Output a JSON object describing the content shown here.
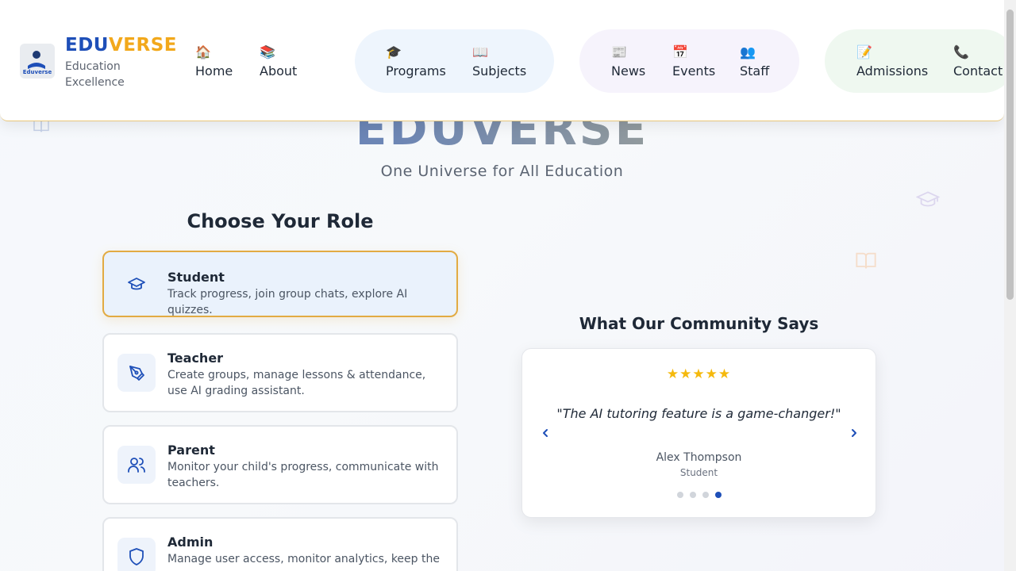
{
  "brand": {
    "name_part1": "EDU",
    "name_part2": "VERSE",
    "tagline": "Education Excellence",
    "logo_text": "Eduverse"
  },
  "nav": [
    {
      "icon": "🏠",
      "label": "Home"
    },
    {
      "icon": "📚",
      "label": "About"
    },
    {
      "icon": "🎓",
      "label": "Programs"
    },
    {
      "icon": "📖",
      "label": "Subjects"
    },
    {
      "icon": "📰",
      "label": "News"
    },
    {
      "icon": "📅",
      "label": "Events"
    },
    {
      "icon": "👥",
      "label": "Staff"
    },
    {
      "icon": "📝",
      "label": "Admissions"
    },
    {
      "icon": "📞",
      "label": "Contact"
    }
  ],
  "hero": {
    "title": "EDUVERSE",
    "subtitle": "One Universe for All Education"
  },
  "roles": {
    "title": "Choose Your Role",
    "items": [
      {
        "name": "Student",
        "desc": "Track progress, join group chats, explore AI quizzes.",
        "icon": "graduation-cap-icon",
        "active": true
      },
      {
        "name": "Teacher",
        "desc": "Create groups, manage lessons & attendance, use AI grading assistant.",
        "icon": "pen-tool-icon",
        "active": false
      },
      {
        "name": "Parent",
        "desc": "Monitor your child's progress, communicate with teachers.",
        "icon": "users-icon",
        "active": false
      },
      {
        "name": "Admin",
        "desc": "Manage user access, monitor analytics, keep the",
        "icon": "shield-icon",
        "active": false
      }
    ]
  },
  "testimonials": {
    "title": "What Our Community Says",
    "rating": 5,
    "quote": "\"The AI tutoring feature is a game-changer!\"",
    "author": "Alex Thompson",
    "author_role": "Student",
    "slide_count": 4,
    "active_slide": 4
  },
  "colors": {
    "brand_blue": "#1e4fb8",
    "brand_gold": "#f2a81b",
    "active_border": "#e2ab43",
    "star": "#f5b90c"
  }
}
